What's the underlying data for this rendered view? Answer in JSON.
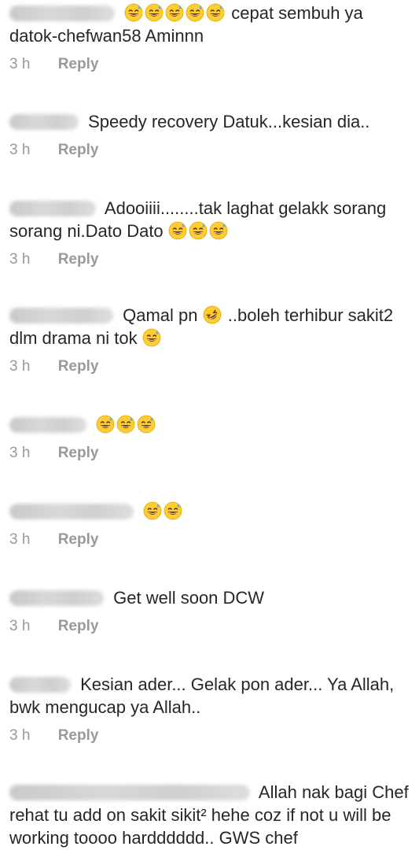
{
  "comments": [
    {
      "text": "cepat sembuh ya datok-chefwan58 Aminnn",
      "time": "3 h",
      "reply": "Reply",
      "emojis_before": 5
    },
    {
      "text": "Speedy recovery Datuk...kesian dia..",
      "time": "3 h",
      "reply": "Reply"
    },
    {
      "text": "Adooiiii........tak laghat gelakk sorang sorang ni.Dato Dato",
      "time": "3 h",
      "reply": "Reply",
      "emojis_after": 3
    },
    {
      "text_a": "Qamal pn",
      "text_b": "..boleh terhibur sakit2 dlm drama ni tok",
      "time": "3 h",
      "reply": "Reply"
    },
    {
      "time": "3 h",
      "reply": "Reply",
      "emojis_after": 3
    },
    {
      "time": "3 h",
      "reply": "Reply",
      "emojis_after": 2
    },
    {
      "text": "Get well soon DCW",
      "time": "3 h",
      "reply": "Reply"
    },
    {
      "text": "Kesian ader... Gelak pon ader... Ya Allah, bwk mengucap ya Allah..",
      "time": "3 h",
      "reply": "Reply"
    },
    {
      "text": "Allah nak bagi Chef rehat tu add on sakit sikit² hehe coz if not u will be working toooo hardddddd.. GWS chef"
    }
  ],
  "icons": {
    "grin_sweat": "grinning-face-with-sweat-icon",
    "rofl": "rolling-on-floor-laughing-icon"
  }
}
